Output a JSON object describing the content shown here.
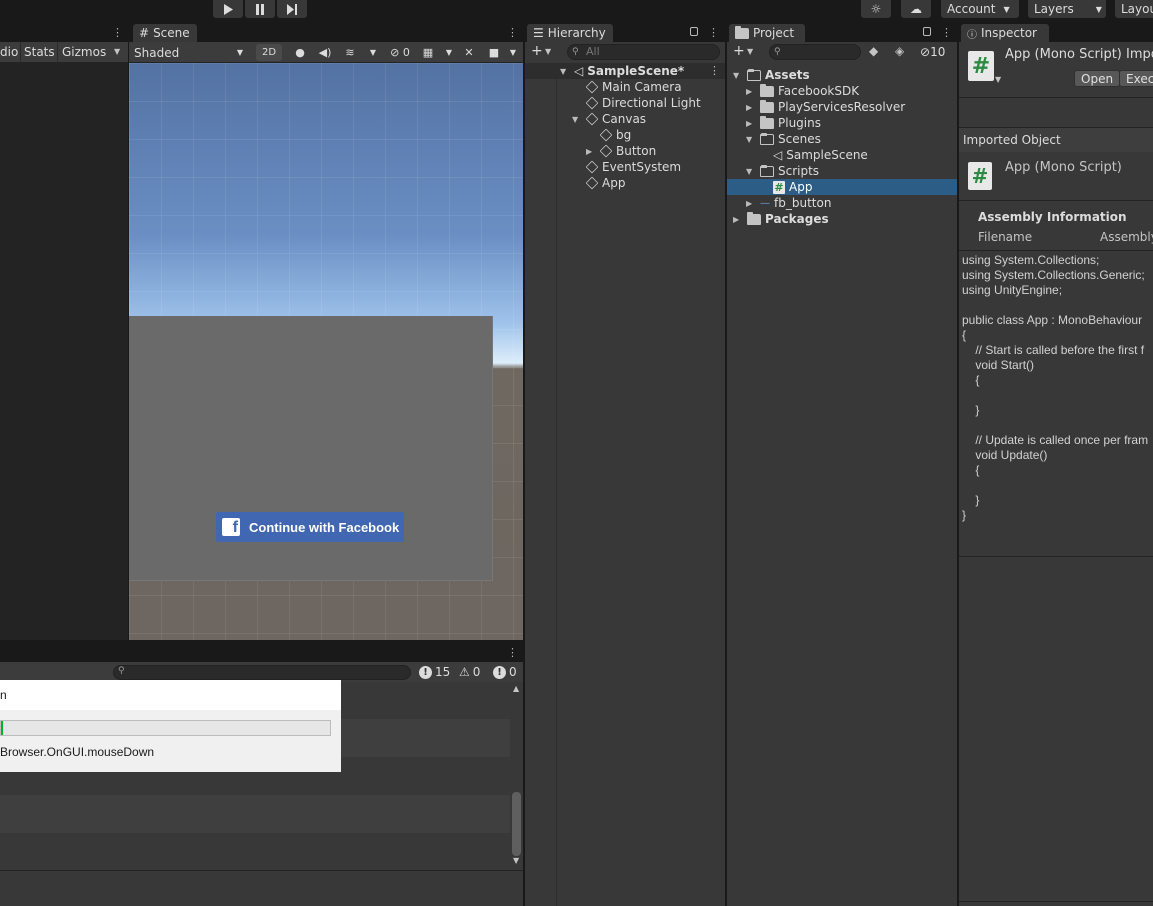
{
  "toolbar": {
    "account_label": "Account",
    "layers_label": "Layers",
    "layout_label": "Layou"
  },
  "game": {
    "toolbar_items": [
      "dio",
      "Stats",
      "Gizmos"
    ]
  },
  "scene": {
    "tab_label": "Scene",
    "shading_mode": "Shaded",
    "mode_2d": "2D",
    "hidden_count": "0",
    "fb_button_label": "Continue with Facebook"
  },
  "hierarchy": {
    "tab_label": "Hierarchy",
    "search_placeholder": "All",
    "scene_name": "SampleScene*",
    "items": [
      "Main Camera",
      "Directional Light",
      "Canvas",
      "bg",
      "Button",
      "EventSystem",
      "App"
    ]
  },
  "project": {
    "tab_label": "Project",
    "package_count": "10",
    "items": [
      "Assets",
      "FacebookSDK",
      "PlayServicesResolver",
      "Plugins",
      "Scenes",
      "SampleScene",
      "Scripts",
      "App",
      "fb_button",
      "Packages"
    ]
  },
  "inspector": {
    "tab_label": "Inspector",
    "title": "App (Mono Script) Impo",
    "open_label": "Open",
    "exec_label": "Exec",
    "imported_object_label": "Imported Object",
    "object_name": "App (Mono Script)",
    "assembly_info_label": "Assembly Information",
    "filename_label": "Filename",
    "assembly_label": "Assembly",
    "code": "using System.Collections;\nusing System.Collections.Generic;\nusing UnityEngine;\n\npublic class App : MonoBehaviour\n{\n    // Start is called before the first f\n    void Start()\n    {\n\n    }\n\n    // Update is called once per fram\n    void Update()\n    {\n\n    }\n}"
  },
  "console": {
    "log_count": "15",
    "warning_count": "0",
    "error_count": "0"
  },
  "progress_dialog": {
    "title": "n",
    "progress_fraction": 0.005,
    "message": "Browser.OnGUI.mouseDown"
  },
  "colors": {
    "selection": "#2c5d87",
    "facebook_blue": "#4267b2",
    "progress_green": "#06b025"
  }
}
